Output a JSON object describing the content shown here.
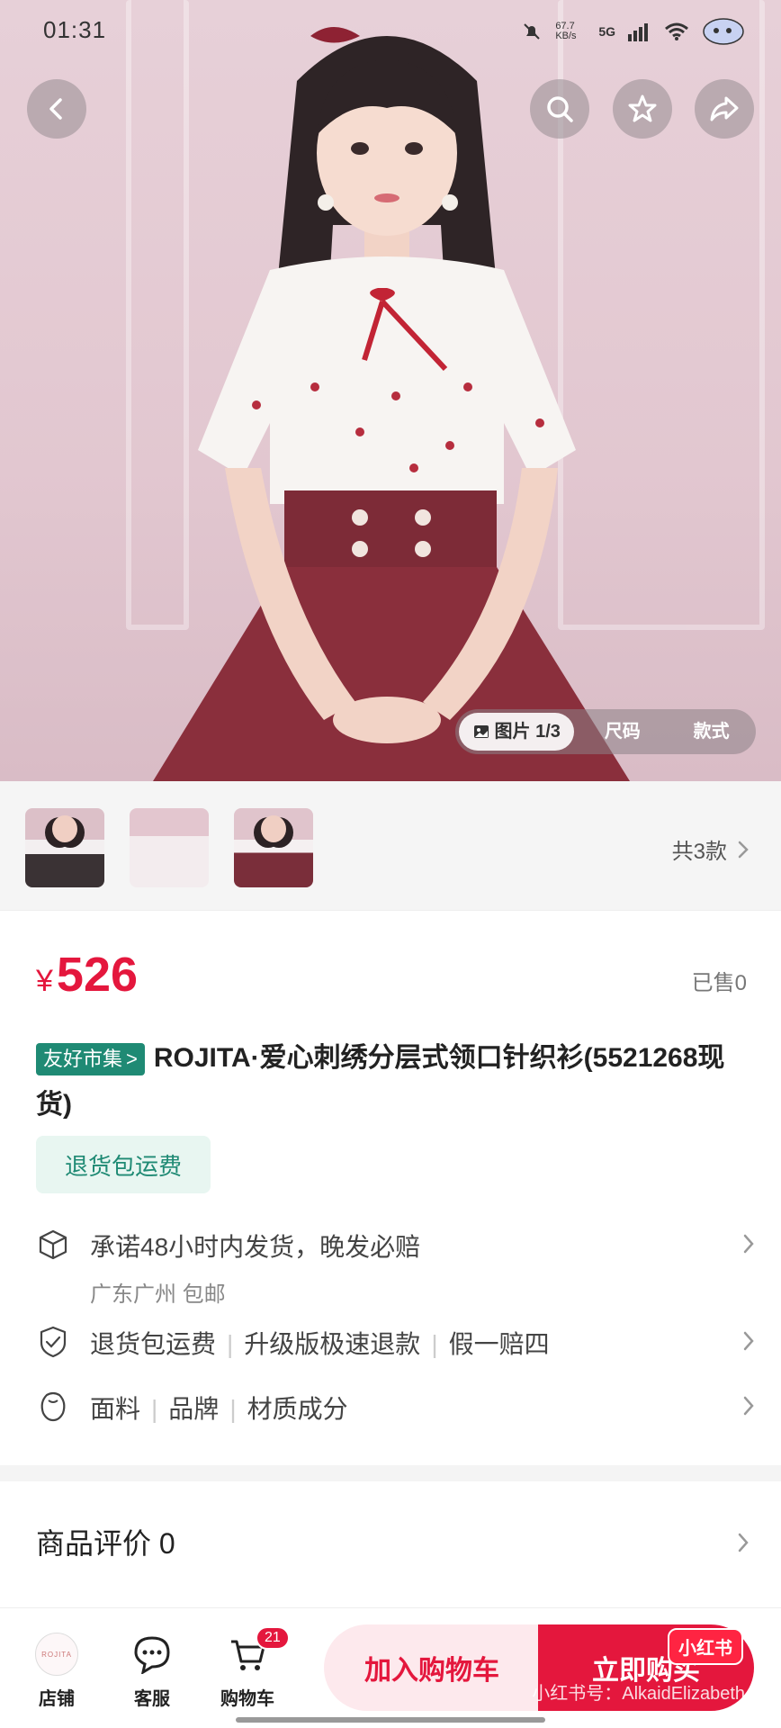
{
  "status_bar": {
    "time": "01:31",
    "net_speed": "67.7 KB/s",
    "network": "5G"
  },
  "hero": {
    "tabs": [
      {
        "label": "图片 1/3",
        "active": true
      },
      {
        "label": "尺码",
        "active": false
      },
      {
        "label": "款式",
        "active": false
      }
    ]
  },
  "thumbs": {
    "variants_label": "共3款"
  },
  "product": {
    "currency": "¥",
    "price": "526",
    "sold": "已售0",
    "tag": "友好市集",
    "tag_arrow": ">",
    "title": "ROJITA·爱心刺绣分层式领口针织衫(5521268现货)",
    "refund_badge": "退货包运费"
  },
  "services": [
    {
      "icon": "box-icon",
      "text": "承诺48小时内发货，晚发必赔",
      "sub": "广东广州 包邮"
    },
    {
      "icon": "shield-check-icon",
      "parts": [
        "退货包运费",
        "升级版极速退款",
        "假一赔四"
      ]
    },
    {
      "icon": "fabric-icon",
      "parts": [
        "面料",
        "品牌",
        "材质成分"
      ]
    }
  ],
  "reviews": {
    "label": "商品评价 0"
  },
  "bottom_bar": {
    "store_label": "店铺",
    "store_logo_text": "ROJITA",
    "service_label": "客服",
    "cart_label": "购物车",
    "cart_count": "21",
    "add_to_cart": "加入购物车",
    "buy_now": "立即购买"
  },
  "watermark": {
    "logo": "小红书",
    "text": "小红书号：AlkaidElizabeth"
  },
  "colors": {
    "accent": "#e4173d",
    "tag_green": "#1f8a74"
  }
}
